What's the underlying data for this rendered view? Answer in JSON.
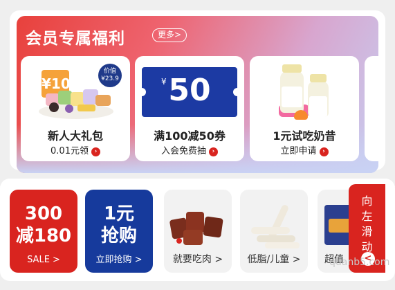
{
  "member_benefits": {
    "title": "会员专属福利",
    "more": "更多>",
    "cards": [
      {
        "title": "新人大礼包",
        "sub": "0.01元领",
        "badge_label": "价值",
        "badge_value": "¥23.9",
        "box_text": "¥10"
      },
      {
        "title": "满100减50券",
        "sub": "入会免费抽",
        "coupon_currency": "¥",
        "coupon_amount": "50"
      },
      {
        "title": "1元试吃奶昔",
        "sub": "立即申请"
      }
    ]
  },
  "promo_row": {
    "sale_tile": {
      "line1": "300",
      "line2": "减180",
      "link": "SALE >"
    },
    "one_yuan_tile": {
      "line1": "1元",
      "line2": "抢购",
      "link": "立即抢购 >"
    },
    "category_tiles": [
      {
        "label": "就要吃肉 >"
      },
      {
        "label": "低脂/儿童 >"
      },
      {
        "label": "超值"
      }
    ],
    "swipe": {
      "text": "向左滑动",
      "arrow": "<"
    }
  },
  "watermark": "quanb5.com",
  "colors": {
    "brand_red": "#d9241f",
    "brand_blue": "#163a9c"
  }
}
